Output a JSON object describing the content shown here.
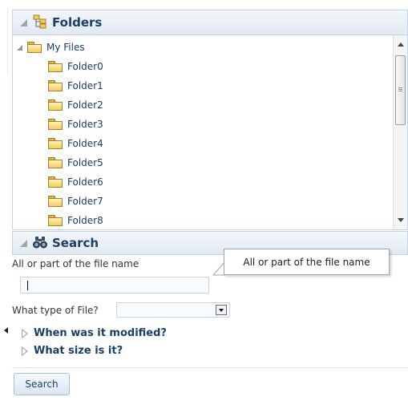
{
  "folders": {
    "title": "Folders",
    "root": "My Files",
    "items": [
      "Folder0",
      "Folder1",
      "Folder2",
      "Folder3",
      "Folder4",
      "Folder5",
      "Folder6",
      "Folder7",
      "Folder8"
    ]
  },
  "search": {
    "title": "Search",
    "name_label": "All or part of the file name",
    "name_value": "",
    "type_label": "What type of File?",
    "type_value": "",
    "modified_label": "When was it modified?",
    "size_label": "What size is it?",
    "button_label": "Search"
  },
  "tooltip": {
    "text": "All or part of the file name"
  },
  "icons": {
    "folders_header": "folder-tree-icon",
    "search_header": "binoculars-icon",
    "folder": "folder-icon"
  },
  "colors": {
    "header_bg": "#e1e9f1",
    "header_text": "#1d3f66",
    "link_text": "#1b3c6b"
  }
}
